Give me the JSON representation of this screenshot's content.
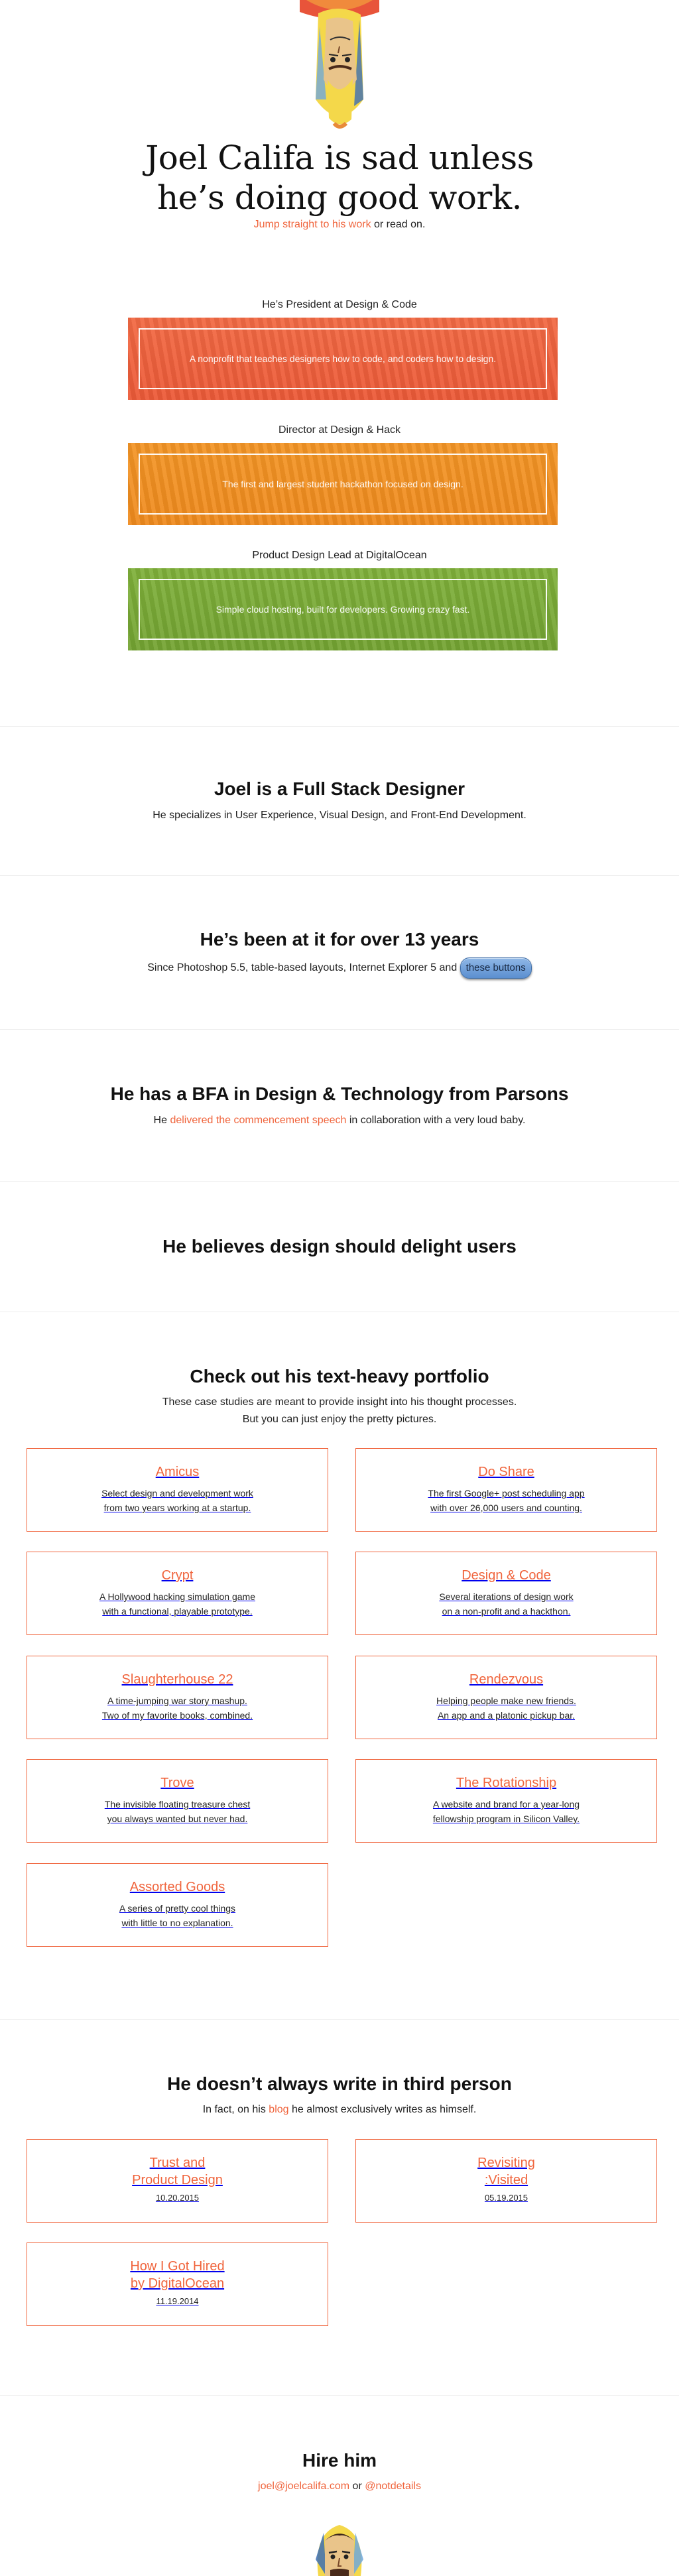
{
  "hero": {
    "title_line1": "Joel Califa is sad unless",
    "title_line2": "he’s doing good work.",
    "sub_link": "Jump straight to his work",
    "sub_rest": " or read on."
  },
  "roles": [
    {
      "label": "He’s President at Design & Code",
      "desc": "A nonprofit that teaches designers how to code, and coders how to design."
    },
    {
      "label": "Director at Design & Hack",
      "desc": "The first and largest student hackathon focused on design."
    },
    {
      "label": "Product Design Lead at DigitalOcean",
      "desc": "Simple cloud hosting, built for developers. Growing crazy fast."
    }
  ],
  "fullstack": {
    "title": "Joel is a Full Stack Designer",
    "text": "He specializes in User Experience, Visual Design, and Front-End Development."
  },
  "years": {
    "title": "He’s been at it for over 13 years",
    "text": "Since Photoshop 5.5, table-based layouts, Internet Explorer 5 and ",
    "pill": "these buttons"
  },
  "bfa": {
    "title": "He has a BFA in Design & Technology from Parsons",
    "text_before": "He ",
    "link": "delivered the commencement speech",
    "text_after": " in collaboration with a very loud baby."
  },
  "delight": {
    "title": "He believes design should delight users"
  },
  "portfolio": {
    "title": "Check out his text-heavy portfolio",
    "line1": "These case studies are meant to provide insight into his thought processes.",
    "line2": "But you can just enjoy the pretty pictures.",
    "items": [
      {
        "title": "Amicus",
        "d1": "Select design and development work",
        "d2": "from two years working at a startup."
      },
      {
        "title": "Do Share",
        "d1": "The first Google+ post scheduling app",
        "d2": "with over 26,000 users and counting."
      },
      {
        "title": "Crypt",
        "d1": "A Hollywood hacking simulation game",
        "d2": "with a functional, playable prototype."
      },
      {
        "title": "Design & Code",
        "d1": "Several iterations of design work",
        "d2": "on a non-profit and a hackthon."
      },
      {
        "title": "Slaughterhouse 22",
        "d1": "A time-jumping war story mashup.",
        "d2": "Two of my favorite books, combined."
      },
      {
        "title": "Rendezvous",
        "d1": "Helping people make new friends.",
        "d2": "An app and a platonic pickup bar."
      },
      {
        "title": "Trove",
        "d1": "The invisible floating treasure chest",
        "d2": "you always wanted but never had."
      },
      {
        "title": "The Rotationship",
        "d1": "A website and brand for a year-long",
        "d2": "fellowship program in Silicon Valley."
      },
      {
        "title": "Assorted Goods",
        "d1": "A series of pretty cool things",
        "d2": "with little to no explanation."
      }
    ]
  },
  "blog": {
    "title": "He doesn’t always write in third person",
    "text_before": "In fact, on his ",
    "link": "blog",
    "text_after": " he almost exclusively writes as himself.",
    "posts": [
      {
        "t1": "Trust and",
        "t2": "Product Design",
        "date": "10.20.2015"
      },
      {
        "t1": "Revisiting",
        "t2": ":Visited",
        "date": "05.19.2015"
      },
      {
        "t1": "How I Got Hired",
        "t2": "by DigitalOcean",
        "date": "11.19.2014"
      }
    ]
  },
  "hire": {
    "title": "Hire him",
    "email": "joel@joelcalifa.com",
    "or": " or ",
    "twitter": "@notdetails"
  }
}
